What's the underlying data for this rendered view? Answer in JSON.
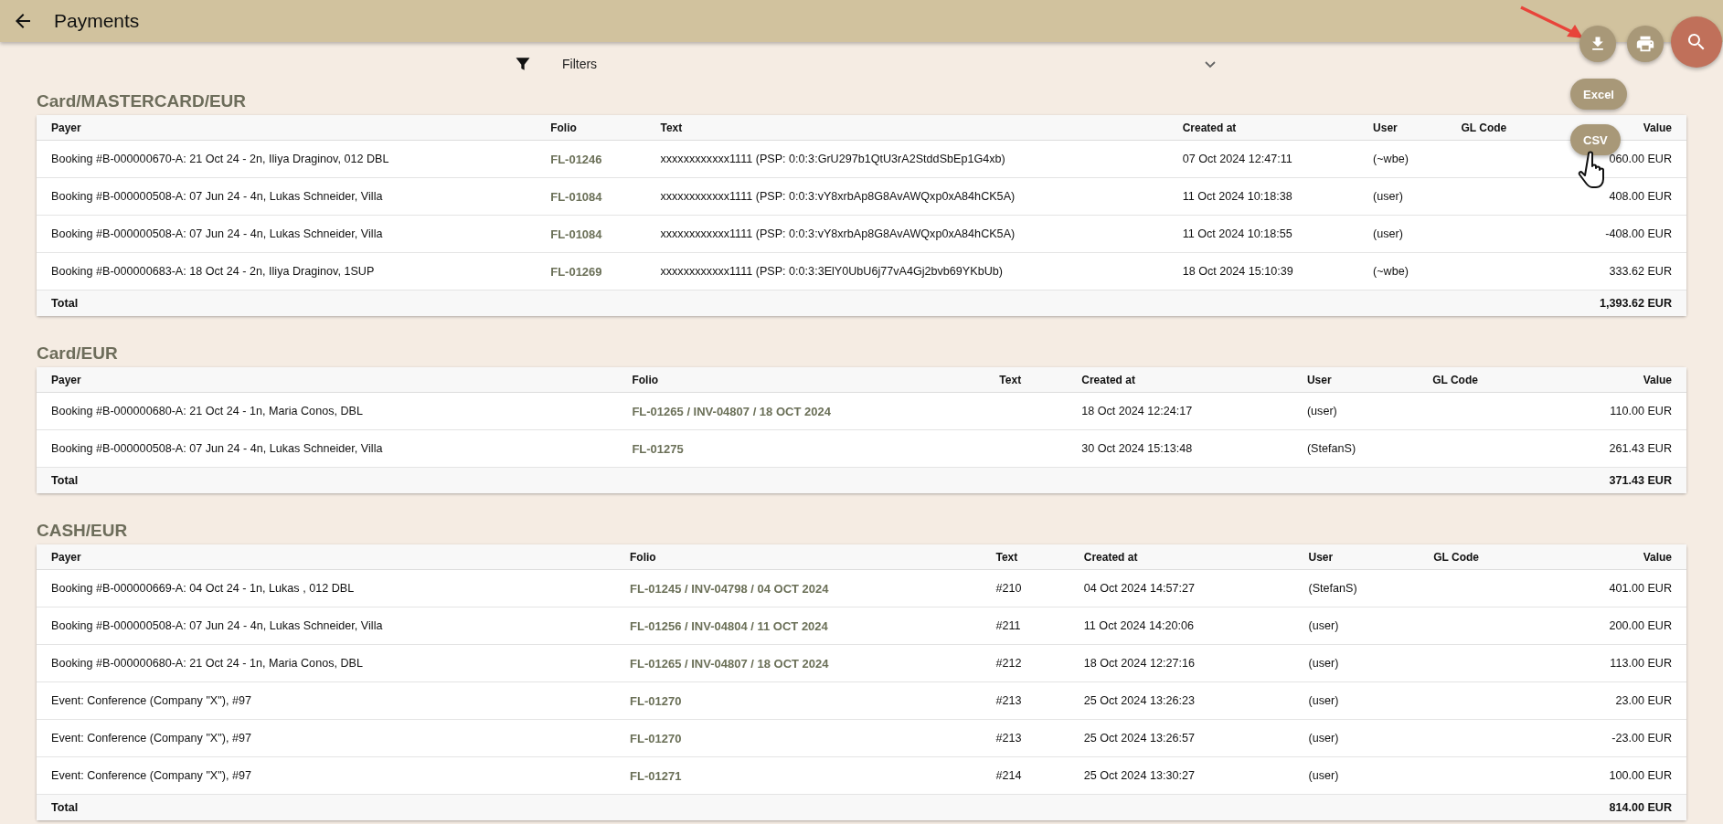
{
  "app_bar": {
    "title": "Payments"
  },
  "filters": {
    "label": "Filters"
  },
  "export_menu": {
    "options": [
      "Excel",
      "CSV"
    ]
  },
  "sections": [
    {
      "title": "Card/MASTERCARD/EUR",
      "columns": [
        "Payer",
        "Folio",
        "Text",
        "Created at",
        "User",
        "GL Code",
        "Value"
      ],
      "rows": [
        {
          "payer": "Booking #B-000000670-A: 21 Oct 24 - 2n, Iliya Draginov, 012 DBL",
          "folio": "FL-01246",
          "text": "xxxxxxxxxxxx1111 (PSP: 0:0:3:GrU297b1QtU3rA2StddSbEp1G4xb)",
          "created_at": "07 Oct 2024 12:47:11",
          "user": "(~wbe)",
          "value": "060.00 EUR"
        },
        {
          "payer": "Booking #B-000000508-A: 07 Jun 24 - 4n, Lukas Schneider, Villa",
          "folio": "FL-01084",
          "text": "xxxxxxxxxxxx1111 (PSP: 0:0:3:vY8xrbAp8G8AvAWQxp0xA84hCK5A)",
          "created_at": "11 Oct 2024 10:18:38",
          "user": "(user)",
          "value": "408.00 EUR"
        },
        {
          "payer": "Booking #B-000000508-A: 07 Jun 24 - 4n, Lukas Schneider, Villa",
          "folio": "FL-01084",
          "text": "xxxxxxxxxxxx1111 (PSP: 0:0:3:vY8xrbAp8G8AvAWQxp0xA84hCK5A)",
          "created_at": "11 Oct 2024 10:18:55",
          "user": "(user)",
          "value": "-408.00 EUR"
        },
        {
          "payer": "Booking #B-000000683-A: 18 Oct 24 - 2n, Iliya Draginov, 1SUP",
          "folio": "FL-01269",
          "text": "xxxxxxxxxxxx1111 (PSP: 0:0:3:3ElY0UbU6j77vA4Gj2bvb69YKbUb)",
          "created_at": "18 Oct 2024 15:10:39",
          "user": "(~wbe)",
          "value": "333.62 EUR"
        }
      ],
      "total": {
        "label": "Total",
        "value": "1,393.62 EUR"
      }
    },
    {
      "title": "Card/EUR",
      "columns": [
        "Payer",
        "Folio",
        "Text",
        "Created at",
        "User",
        "GL Code",
        "Value"
      ],
      "rows": [
        {
          "payer": "Booking #B-000000680-A: 21 Oct 24 - 1n, Maria Conos, DBL",
          "folio": "FL-01265 / INV-04807 / 18 OCT 2024",
          "created_at": "18 Oct 2024 12:24:17",
          "user": "(user)",
          "value": "110.00 EUR"
        },
        {
          "payer": "Booking #B-000000508-A: 07 Jun 24 - 4n, Lukas Schneider, Villa",
          "folio": "FL-01275",
          "created_at": "30 Oct 2024 15:13:48",
          "user": "(StefanS)",
          "value": "261.43 EUR"
        }
      ],
      "total": {
        "label": "Total",
        "value": "371.43 EUR"
      }
    },
    {
      "title": "CASH/EUR",
      "columns": [
        "Payer",
        "Folio",
        "Text",
        "Created at",
        "User",
        "GL Code",
        "Value"
      ],
      "rows": [
        {
          "payer": "Booking #B-000000669-A: 04 Oct 24 - 1n,  Lukas    , 012 DBL",
          "folio": "FL-01245 / INV-04798 / 04 OCT 2024",
          "text": "#210",
          "created_at": "04 Oct 2024 14:57:27",
          "user": "(StefanS)",
          "value": "401.00 EUR"
        },
        {
          "payer": "Booking #B-000000508-A: 07 Jun 24 - 4n, Lukas Schneider, Villa",
          "folio": "FL-01256 / INV-04804 / 11 OCT 2024",
          "text": "#211",
          "created_at": "11 Oct 2024 14:20:06",
          "user": "(user)",
          "value": "200.00 EUR"
        },
        {
          "payer": "Booking #B-000000680-A: 21 Oct 24 - 1n, Maria Conos, DBL",
          "folio": "FL-01265 / INV-04807 / 18 OCT 2024",
          "text": "#212",
          "created_at": "18 Oct 2024 12:27:16",
          "user": "(user)",
          "value": "113.00 EUR"
        },
        {
          "payer": "Event: Conference (Company \"X\"), #97",
          "folio": "FL-01270",
          "text": "#213",
          "created_at": "25 Oct 2024 13:26:23",
          "user": "(user)",
          "value": "23.00 EUR"
        },
        {
          "payer": "Event: Conference (Company \"X\"), #97",
          "folio": "FL-01270",
          "text": "#213",
          "created_at": "25 Oct 2024 13:26:57",
          "user": "(user)",
          "value": "-23.00 EUR"
        },
        {
          "payer": "Event: Conference (Company \"X\"), #97",
          "folio": "FL-01271",
          "text": "#214",
          "created_at": "25 Oct 2024 13:30:27",
          "user": "(user)",
          "value": "100.00 EUR"
        }
      ],
      "total": {
        "label": "Total",
        "value": "814.00 EUR"
      }
    }
  ]
}
